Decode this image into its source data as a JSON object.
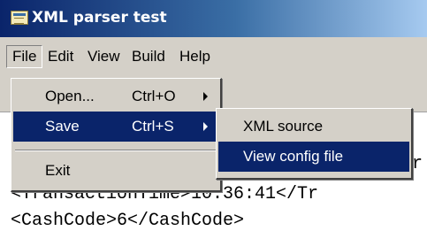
{
  "window": {
    "title": "XML parser test"
  },
  "menubar": {
    "items": [
      "File",
      "Edit",
      "View",
      "Build",
      "Help"
    ]
  },
  "file_menu": {
    "items": [
      {
        "label": "Open...",
        "shortcut": "Ctrl+O"
      },
      {
        "label": "Save",
        "shortcut": "Ctrl+S"
      },
      {
        "label": "Exit"
      }
    ]
  },
  "save_submenu": {
    "items": [
      "XML source",
      "View config file"
    ]
  },
  "editor": {
    "lines": [
      "r",
      "<TransactionTime>10:36:41</Tr",
      "<CashCode>6</CashCode>"
    ]
  },
  "colors": {
    "highlight": "#0a246a",
    "menu_bg": "#d4d0c8"
  }
}
